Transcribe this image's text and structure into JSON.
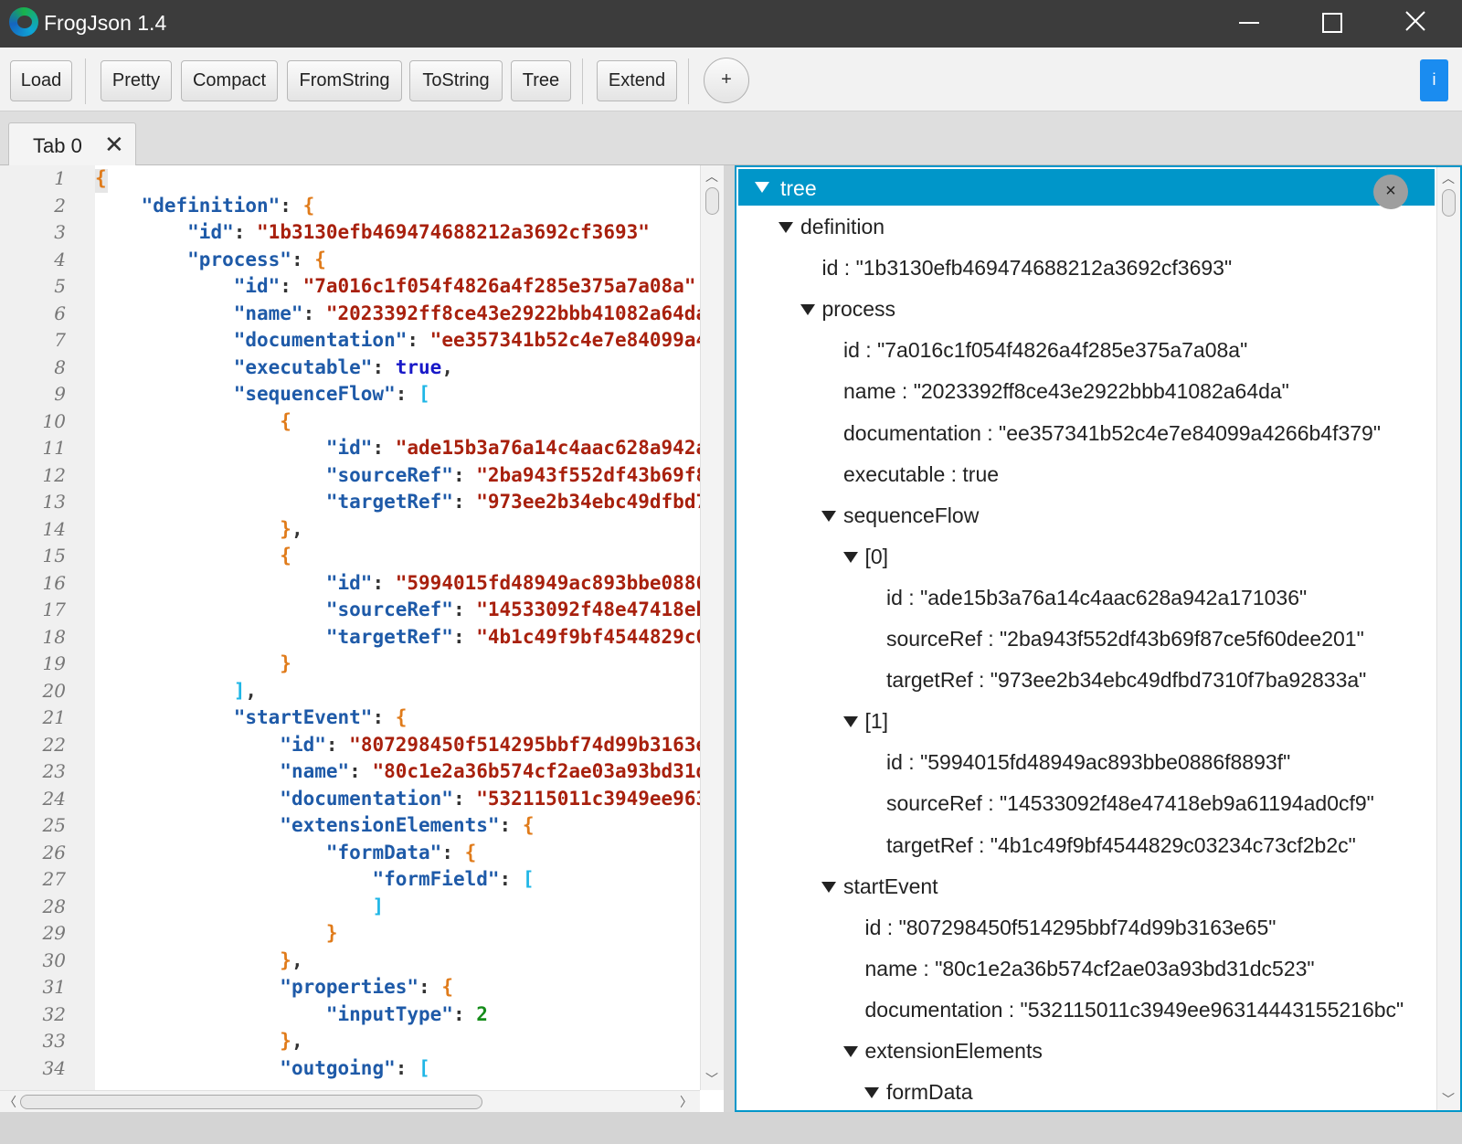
{
  "window": {
    "title": "FrogJson 1.4",
    "controls": {
      "minimize": "minimize",
      "maximize": "maximize",
      "close": "close"
    }
  },
  "toolbar": {
    "buttons": {
      "load": "Load",
      "pretty": "Pretty",
      "compact": "Compact",
      "fromstring": "FromString",
      "tostring": "ToString",
      "tree": "Tree",
      "extend": "Extend",
      "plus": "+",
      "info": "i"
    }
  },
  "tabs": [
    {
      "label": "Tab 0",
      "close": "✕"
    }
  ],
  "editor": {
    "line_numbers": [
      "1",
      "2",
      "3",
      "4",
      "5",
      "6",
      "7",
      "8",
      "9",
      "10",
      "11",
      "12",
      "13",
      "14",
      "15",
      "16",
      "17",
      "18",
      "19",
      "20",
      "21",
      "22",
      "23",
      "24",
      "25",
      "26",
      "27",
      "28",
      "29",
      "30",
      "31",
      "32",
      "33",
      "34"
    ],
    "lines": [
      {
        "indent": "",
        "tokens": [
          {
            "t": "{",
            "c": "b"
          }
        ]
      },
      {
        "indent": "    ",
        "tokens": [
          {
            "t": "\"definition\"",
            "c": "k"
          },
          {
            "t": ": ",
            "c": "p"
          },
          {
            "t": "{",
            "c": "b"
          }
        ]
      },
      {
        "indent": "        ",
        "tokens": [
          {
            "t": "\"id\"",
            "c": "k"
          },
          {
            "t": ": ",
            "c": "p"
          },
          {
            "t": "\"1b3130efb469474688212a3692cf3693\"",
            "c": "s"
          }
        ]
      },
      {
        "indent": "        ",
        "tokens": [
          {
            "t": "\"process\"",
            "c": "k"
          },
          {
            "t": ": ",
            "c": "p"
          },
          {
            "t": "{",
            "c": "b"
          }
        ]
      },
      {
        "indent": "            ",
        "tokens": [
          {
            "t": "\"id\"",
            "c": "k"
          },
          {
            "t": ": ",
            "c": "p"
          },
          {
            "t": "\"7a016c1f054f4826a4f285e375a7a08a\"",
            "c": "s"
          }
        ]
      },
      {
        "indent": "            ",
        "tokens": [
          {
            "t": "\"name\"",
            "c": "k"
          },
          {
            "t": ": ",
            "c": "p"
          },
          {
            "t": "\"2023392ff8ce43e2922bbb41082a64da\"",
            "c": "s"
          }
        ]
      },
      {
        "indent": "            ",
        "tokens": [
          {
            "t": "\"documentation\"",
            "c": "k"
          },
          {
            "t": ": ",
            "c": "p"
          },
          {
            "t": "\"ee357341b52c4e7e84099a4266b4f379\"",
            "c": "s"
          }
        ]
      },
      {
        "indent": "            ",
        "tokens": [
          {
            "t": "\"executable\"",
            "c": "k"
          },
          {
            "t": ": ",
            "c": "p"
          },
          {
            "t": "true",
            "c": "kw"
          },
          {
            "t": ",",
            "c": "p"
          }
        ]
      },
      {
        "indent": "            ",
        "tokens": [
          {
            "t": "\"sequenceFlow\"",
            "c": "k"
          },
          {
            "t": ": ",
            "c": "p"
          },
          {
            "t": "[",
            "c": "br"
          }
        ]
      },
      {
        "indent": "                ",
        "tokens": [
          {
            "t": "{",
            "c": "b"
          }
        ]
      },
      {
        "indent": "                    ",
        "tokens": [
          {
            "t": "\"id\"",
            "c": "k"
          },
          {
            "t": ": ",
            "c": "p"
          },
          {
            "t": "\"ade15b3a76a14c4aac628a942a171036\"",
            "c": "s"
          }
        ]
      },
      {
        "indent": "                    ",
        "tokens": [
          {
            "t": "\"sourceRef\"",
            "c": "k"
          },
          {
            "t": ": ",
            "c": "p"
          },
          {
            "t": "\"2ba943f552df43b69f87ce5f60dee201\"",
            "c": "s"
          }
        ]
      },
      {
        "indent": "                    ",
        "tokens": [
          {
            "t": "\"targetRef\"",
            "c": "k"
          },
          {
            "t": ": ",
            "c": "p"
          },
          {
            "t": "\"973ee2b34ebc49dfbd7310f7ba92833a\"",
            "c": "s"
          }
        ]
      },
      {
        "indent": "                ",
        "tokens": [
          {
            "t": "}",
            "c": "b"
          },
          {
            "t": ",",
            "c": "p"
          }
        ]
      },
      {
        "indent": "                ",
        "tokens": [
          {
            "t": "{",
            "c": "b"
          }
        ]
      },
      {
        "indent": "                    ",
        "tokens": [
          {
            "t": "\"id\"",
            "c": "k"
          },
          {
            "t": ": ",
            "c": "p"
          },
          {
            "t": "\"5994015fd48949ac893bbe0886f8893f\"",
            "c": "s"
          }
        ]
      },
      {
        "indent": "                    ",
        "tokens": [
          {
            "t": "\"sourceRef\"",
            "c": "k"
          },
          {
            "t": ": ",
            "c": "p"
          },
          {
            "t": "\"14533092f48e47418eb9a61194ad0cf9\"",
            "c": "s"
          }
        ]
      },
      {
        "indent": "                    ",
        "tokens": [
          {
            "t": "\"targetRef\"",
            "c": "k"
          },
          {
            "t": ": ",
            "c": "p"
          },
          {
            "t": "\"4b1c49f9bf4544829c03234c73cf2b2c\"",
            "c": "s"
          }
        ]
      },
      {
        "indent": "                ",
        "tokens": [
          {
            "t": "}",
            "c": "b"
          }
        ]
      },
      {
        "indent": "            ",
        "tokens": [
          {
            "t": "]",
            "c": "br"
          },
          {
            "t": ",",
            "c": "p"
          }
        ]
      },
      {
        "indent": "            ",
        "tokens": [
          {
            "t": "\"startEvent\"",
            "c": "k"
          },
          {
            "t": ": ",
            "c": "p"
          },
          {
            "t": "{",
            "c": "b"
          }
        ]
      },
      {
        "indent": "                ",
        "tokens": [
          {
            "t": "\"id\"",
            "c": "k"
          },
          {
            "t": ": ",
            "c": "p"
          },
          {
            "t": "\"807298450f514295bbf74d99b3163e65\"",
            "c": "s"
          }
        ]
      },
      {
        "indent": "                ",
        "tokens": [
          {
            "t": "\"name\"",
            "c": "k"
          },
          {
            "t": ": ",
            "c": "p"
          },
          {
            "t": "\"80c1e2a36b574cf2ae03a93bd31dc523\"",
            "c": "s"
          }
        ]
      },
      {
        "indent": "                ",
        "tokens": [
          {
            "t": "\"documentation\"",
            "c": "k"
          },
          {
            "t": ": ",
            "c": "p"
          },
          {
            "t": "\"532115011c3949ee96314443155216bc\"",
            "c": "s"
          }
        ]
      },
      {
        "indent": "                ",
        "tokens": [
          {
            "t": "\"extensionElements\"",
            "c": "k"
          },
          {
            "t": ": ",
            "c": "p"
          },
          {
            "t": "{",
            "c": "b"
          }
        ]
      },
      {
        "indent": "                    ",
        "tokens": [
          {
            "t": "\"formData\"",
            "c": "k"
          },
          {
            "t": ": ",
            "c": "p"
          },
          {
            "t": "{",
            "c": "b"
          }
        ]
      },
      {
        "indent": "                        ",
        "tokens": [
          {
            "t": "\"formField\"",
            "c": "k"
          },
          {
            "t": ": ",
            "c": "p"
          },
          {
            "t": "[",
            "c": "br"
          }
        ]
      },
      {
        "indent": "                        ",
        "tokens": [
          {
            "t": "]",
            "c": "br"
          }
        ]
      },
      {
        "indent": "                    ",
        "tokens": [
          {
            "t": "}",
            "c": "b"
          }
        ]
      },
      {
        "indent": "                ",
        "tokens": [
          {
            "t": "}",
            "c": "b"
          },
          {
            "t": ",",
            "c": "p"
          }
        ]
      },
      {
        "indent": "                ",
        "tokens": [
          {
            "t": "\"properties\"",
            "c": "k"
          },
          {
            "t": ": ",
            "c": "p"
          },
          {
            "t": "{",
            "c": "b"
          }
        ]
      },
      {
        "indent": "                    ",
        "tokens": [
          {
            "t": "\"inputType\"",
            "c": "k"
          },
          {
            "t": ": ",
            "c": "p"
          },
          {
            "t": "2",
            "c": "n"
          }
        ]
      },
      {
        "indent": "                ",
        "tokens": [
          {
            "t": "}",
            "c": "b"
          },
          {
            "t": ",",
            "c": "p"
          }
        ]
      },
      {
        "indent": "                ",
        "tokens": [
          {
            "t": "\"outgoing\"",
            "c": "k"
          },
          {
            "t": ": ",
            "c": "p"
          },
          {
            "t": "[",
            "c": "br"
          }
        ]
      }
    ]
  },
  "tree": {
    "root_label": "tree",
    "close": "×",
    "rows": [
      {
        "level": 0,
        "expandable": true,
        "text": "definition"
      },
      {
        "level": 1,
        "expandable": false,
        "text": "id : \"1b3130efb469474688212a3692cf3693\""
      },
      {
        "level": 1,
        "expandable": true,
        "text": "process"
      },
      {
        "level": 2,
        "expandable": false,
        "text": "id : \"7a016c1f054f4826a4f285e375a7a08a\""
      },
      {
        "level": 2,
        "expandable": false,
        "text": "name : \"2023392ff8ce43e2922bbb41082a64da\""
      },
      {
        "level": 2,
        "expandable": false,
        "text": "documentation : \"ee357341b52c4e7e84099a4266b4f379\""
      },
      {
        "level": 2,
        "expandable": false,
        "text": "executable : true"
      },
      {
        "level": 2,
        "expandable": true,
        "text": "sequenceFlow"
      },
      {
        "level": 3,
        "expandable": true,
        "text": "[0]"
      },
      {
        "level": 4,
        "expandable": false,
        "text": "id : \"ade15b3a76a14c4aac628a942a171036\""
      },
      {
        "level": 4,
        "expandable": false,
        "text": "sourceRef : \"2ba943f552df43b69f87ce5f60dee201\""
      },
      {
        "level": 4,
        "expandable": false,
        "text": "targetRef : \"973ee2b34ebc49dfbd7310f7ba92833a\""
      },
      {
        "level": 3,
        "expandable": true,
        "text": "[1]"
      },
      {
        "level": 4,
        "expandable": false,
        "text": "id : \"5994015fd48949ac893bbe0886f8893f\""
      },
      {
        "level": 4,
        "expandable": false,
        "text": "sourceRef : \"14533092f48e47418eb9a61194ad0cf9\""
      },
      {
        "level": 4,
        "expandable": false,
        "text": "targetRef : \"4b1c49f9bf4544829c03234c73cf2b2c\""
      },
      {
        "level": 2,
        "expandable": true,
        "text": "startEvent"
      },
      {
        "level": 3,
        "expandable": false,
        "text": "id : \"807298450f514295bbf74d99b3163e65\""
      },
      {
        "level": 3,
        "expandable": false,
        "text": "name : \"80c1e2a36b574cf2ae03a93bd31dc523\""
      },
      {
        "level": 3,
        "expandable": false,
        "text": "documentation : \"532115011c3949ee96314443155216bc\""
      },
      {
        "level": 3,
        "expandable": true,
        "text": "extensionElements"
      },
      {
        "level": 4,
        "expandable": true,
        "text": "formData"
      }
    ]
  },
  "colors": {
    "titlebar": "#3c3c3c",
    "tree_header": "#0096c9",
    "info_button": "#1a8cf0",
    "json_key": "#1e5aa8",
    "json_string": "#a8200d",
    "json_brace": "#e07b1a",
    "json_bracket": "#1fb6e6",
    "json_keyword": "#1818c8",
    "json_number": "#158c1a"
  },
  "icons": [
    "app-logo-icon",
    "minimize-icon",
    "maximize-icon",
    "close-icon",
    "tab-close-icon",
    "tree-collapse-icon",
    "tree-close-icon"
  ]
}
